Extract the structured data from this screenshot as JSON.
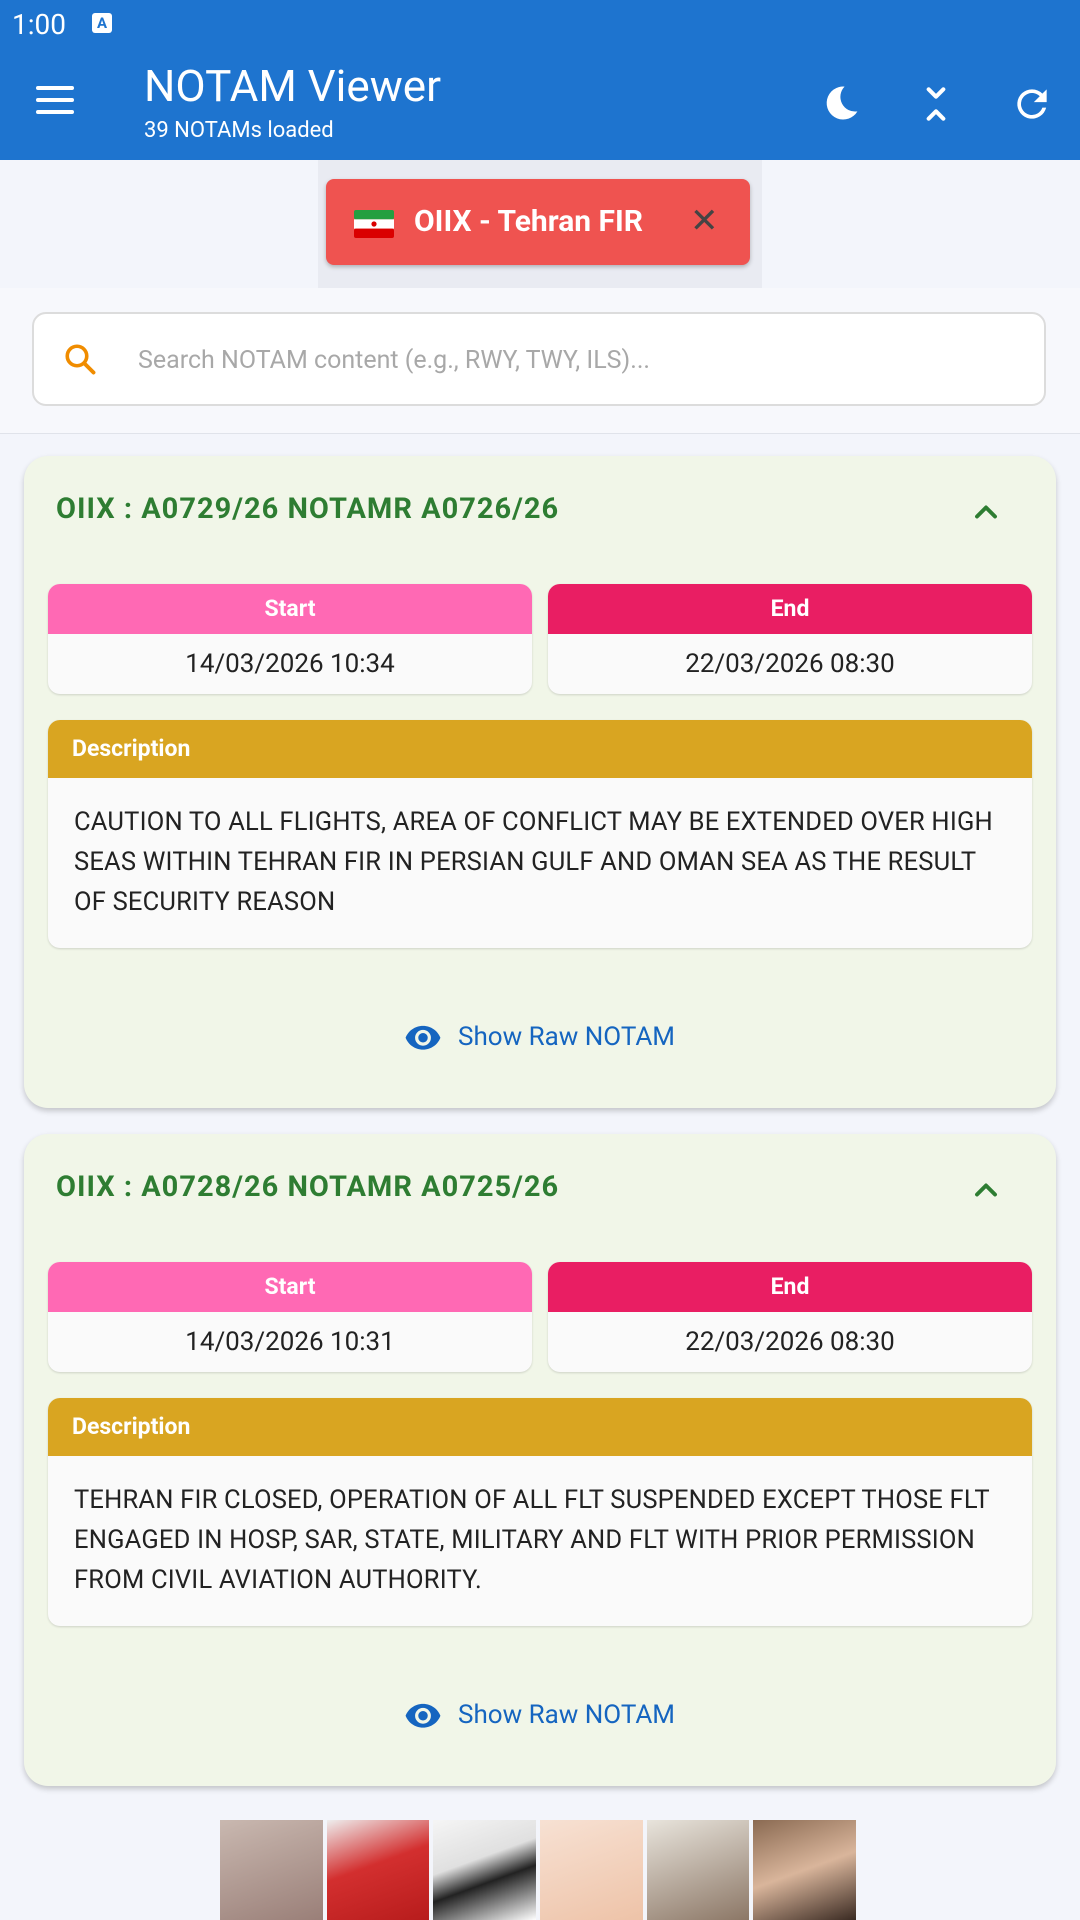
{
  "status_bar": {
    "time": "1:00",
    "icon": "A"
  },
  "app_bar": {
    "title": "NOTAM Viewer",
    "subtitle": "39 NOTAMs loaded",
    "actions": [
      "dark-mode-icon",
      "collapse-all-icon",
      "refresh-icon"
    ]
  },
  "filter_chip": {
    "label": "OIIX - Tehran FIR",
    "flag": "iran-flag-icon"
  },
  "search": {
    "placeholder": "Search NOTAM content (e.g., RWY, TWY, ILS)...",
    "value": ""
  },
  "labels": {
    "start": "Start",
    "end": "End",
    "description": "Description",
    "show_raw": "Show Raw NOTAM"
  },
  "notams": [
    {
      "title": "OIIX : A0729/26 NOTAMR A0726/26",
      "start": "14/03/2026 10:34",
      "end": "22/03/2026 08:30",
      "description": "CAUTION TO ALL FLIGHTS, AREA OF CONFLICT MAY BE EXTENDED OVER HIGH SEAS WITHIN TEHRAN FIR IN PERSIAN GULF AND OMAN SEA AS THE RESULT OF SECURITY REASON"
    },
    {
      "title": "OIIX : A0728/26 NOTAMR A0725/26",
      "start": "14/03/2026 10:31",
      "end": "22/03/2026 08:30",
      "description": "TEHRAN FIR CLOSED, OPERATION OF ALL FLT SUSPENDED EXCEPT  THOSE FLT ENGAGED IN HOSP, SAR, STATE, MILITARY AND  FLT WITH PRIOR PERMISSION FROM CIVIL AVIATION AUTHORITY."
    }
  ],
  "colors": {
    "app_bar": "#1e74cf",
    "chip": "#ef5350",
    "start_header": "#ff69b4",
    "end_header": "#e91e63",
    "description_header": "#d9a521",
    "card_title": "#2e7d32",
    "link": "#1565c0"
  },
  "ad_banner": {
    "items": 6
  }
}
